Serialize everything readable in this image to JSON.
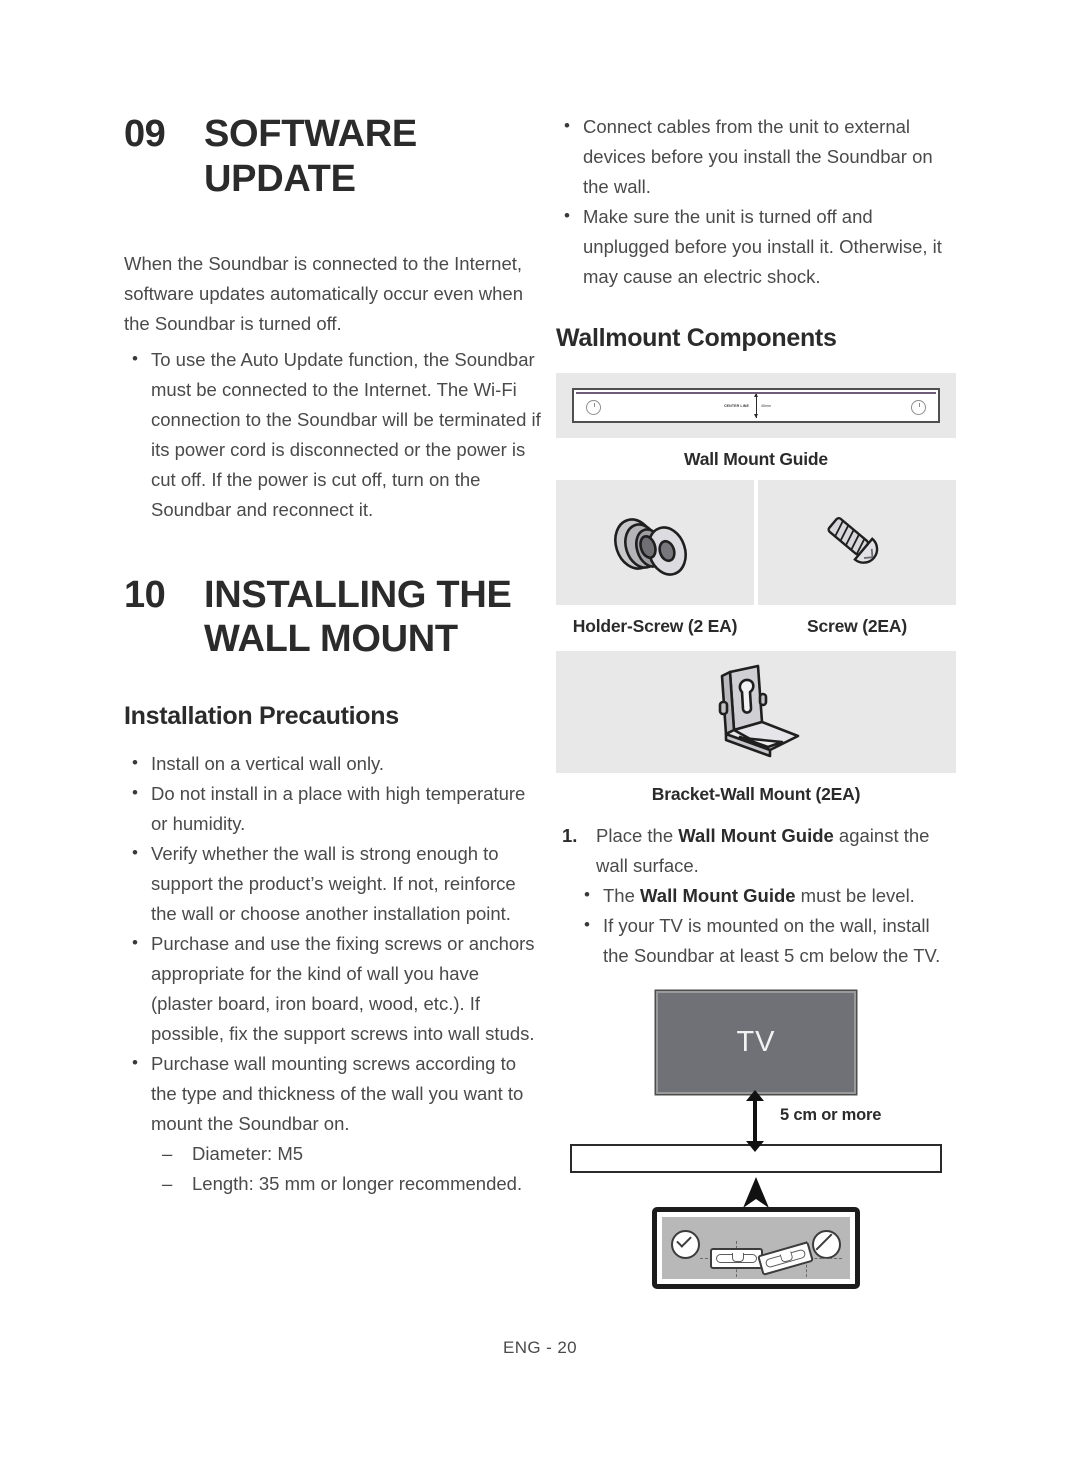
{
  "document": {
    "footer": "ENG - 20"
  },
  "left_column": {
    "chapter_09": {
      "number": "09",
      "title_line1": "SOFTWARE",
      "title_line2": "UPDATE",
      "intro": "When the Soundbar is connected to the Internet, software updates automatically occur even when the Soundbar is turned off.",
      "bullets": [
        "To use the Auto Update function, the Soundbar must be connected to the Internet. The Wi-Fi connection to the Soundbar will be terminated if its power cord is disconnected or the power is cut off. If the power is cut off, turn on the Soundbar and reconnect it."
      ]
    },
    "chapter_10": {
      "number": "10",
      "title_line1": "INSTALLING THE",
      "title_line2": "WALL MOUNT",
      "subheading": "Installation Precautions",
      "bullets": [
        "Install on a vertical wall only.",
        "Do not install in a place with high temperature or humidity.",
        "Verify whether the wall is strong enough to support the product’s weight. If not, reinforce the wall or choose another installation point.",
        "Purchase and use the fixing screws or anchors appropriate for the kind of wall you have (plaster board, iron board, wood, etc.). If possible, fix the support screws into wall studs.",
        "Purchase wall mounting screws according to the type and thickness of the wall you want to mount the Soundbar on."
      ],
      "sub_dashes": [
        "Diameter: M5",
        "Length: 35 mm or longer recommended."
      ]
    }
  },
  "right_column": {
    "top_bullets": [
      "Connect cables from the unit to external devices before you install the Soundbar on the wall.",
      "Make sure the unit is turned off and unplugged before you install it. Otherwise, it may cause an electric shock."
    ],
    "components": {
      "heading": "Wallmount Components",
      "guide_drawing": {
        "center_label": "CENTER LINE",
        "dimension_label": "45mm"
      },
      "items": [
        {
          "caption": "Wall Mount Guide",
          "icon": "wall-mount-guide-bar"
        },
        {
          "caption": "Holder-Screw (2 EA)",
          "icon": "holder-screw"
        },
        {
          "caption": "Screw (2EA)",
          "icon": "screw"
        },
        {
          "caption": "Bracket-Wall Mount (2EA)",
          "icon": "wall-mount-bracket"
        }
      ]
    },
    "steps": [
      {
        "number": "1.",
        "text_before": "Place the ",
        "bold": "Wall Mount Guide",
        "text_after": " against the wall surface."
      }
    ],
    "step_sub_bullets": [
      {
        "text_before": "The ",
        "bold": "Wall Mount Guide",
        "text_after": " must be level."
      },
      {
        "text_before": "If your TV is mounted on the wall, install the Soundbar at least 5 cm below the TV.",
        "bold": "",
        "text_after": ""
      }
    ],
    "tv_diagram": {
      "tv_label": "TV",
      "gap_label": "5 cm or more"
    }
  }
}
